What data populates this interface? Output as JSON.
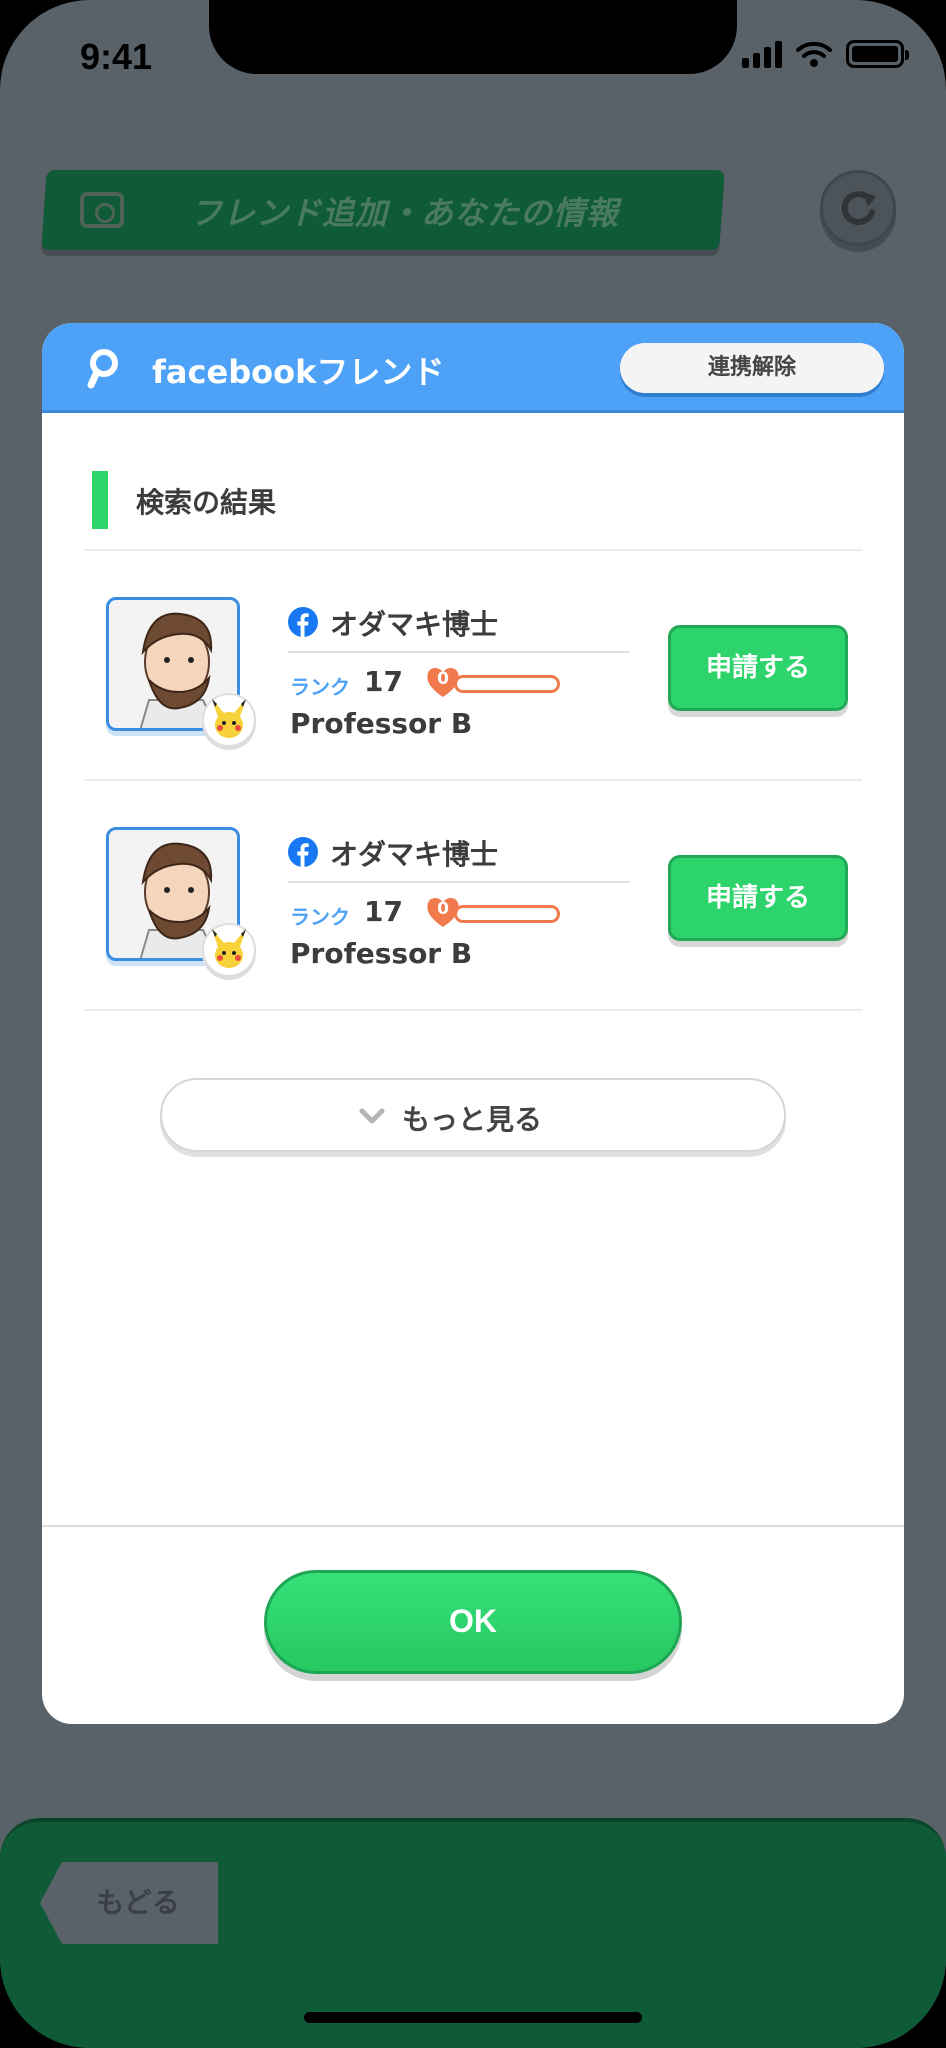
{
  "status_bar": {
    "time": "9:41"
  },
  "background": {
    "banner_title": "フレンド追加・あなたの情報"
  },
  "modal": {
    "title": "facebookフレンド",
    "unlink_label": "連携解除",
    "section_title": "検索の結果",
    "friends": [
      {
        "name": "オダマキ博士",
        "rank_label": "ランク",
        "rank": "17",
        "hearts": "0",
        "friendship_fraction": 0.0,
        "trainer": "Professor B",
        "request_label": "申請する"
      },
      {
        "name": "オダマキ博士",
        "rank_label": "ランク",
        "rank": "17",
        "hearts": "0",
        "friendship_fraction": 0.0,
        "trainer": "Professor B",
        "request_label": "申請する"
      }
    ],
    "more_label": "もっと見る",
    "ok_label": "OK"
  },
  "footer": {
    "back_label": "もどる"
  },
  "colors": {
    "accent_blue": "#4da2f7",
    "accent_green": "#2dd46c",
    "dark_green": "#0f5b37",
    "heart": "#f07a4c"
  },
  "icons": [
    "search-icon",
    "facebook-icon",
    "heart-icon",
    "chevron-down-icon",
    "refresh-icon",
    "camera-icon"
  ]
}
